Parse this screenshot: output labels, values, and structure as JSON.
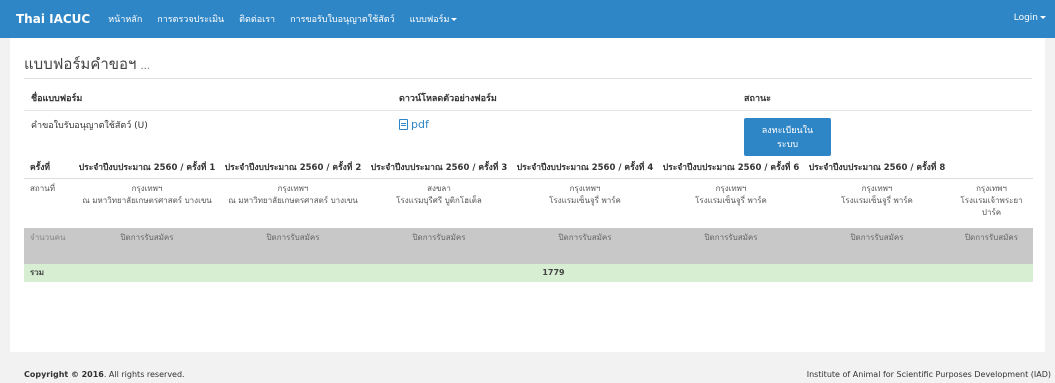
{
  "nav": {
    "brand": "Thai IACUC",
    "links": [
      "หน้าหลัก",
      "การตรวจประเมิน",
      "ติดต่อเรา",
      "การขอรับใบอนุญาตใช้สัตว์"
    ],
    "dropdown": "แบบฟอร์ม",
    "login": "Login"
  },
  "page": {
    "title": "แบบฟอร์มคำขอฯ",
    "title_suffix": "..."
  },
  "form_info": {
    "headers": [
      "ชื่อแบบฟอร์ม",
      "ดาวน์โหลดตัวอย่างฟอร์ม",
      "สถานะ"
    ],
    "name": "คำขอใบรับอนุญาตใช้สัตว์ (U)",
    "download_label": "pdf",
    "status_button": "ลงทะเบียนในระบบ"
  },
  "schedule": {
    "corner": "ครั้งที่",
    "rounds": [
      {
        "header": "ประจำปีงบประมาณ 2560 / ครั้งที่ 1",
        "place": "กรุงเทพฯ",
        "venue": "ณ มหาวิทยาลัยเกษตรศาสตร์ บางเขน",
        "count": "ปิดการรับสมัคร"
      },
      {
        "header": "ประจำปีงบประมาณ 2560 / ครั้งที่ 2",
        "place": "กรุงเทพฯ",
        "venue": "ณ มหาวิทยาลัยเกษตรศาสตร์ บางเขน",
        "count": "ปิดการรับสมัคร"
      },
      {
        "header": "ประจำปีงบประมาณ 2560 / ครั้งที่ 3",
        "place": "สงขลา",
        "venue": "โรงแรมบุรีศรี บูติกโฮเต็ล",
        "count": "ปิดการรับสมัคร"
      },
      {
        "header": "ประจำปีงบประมาณ 2560 / ครั้งที่ 4",
        "place": "กรุงเทพฯ",
        "venue": "โรงแรมเซ็นจูรี่ พาร์ค",
        "count": "ปิดการรับสมัคร"
      },
      {
        "header": "ประจำปีงบประมาณ 2560 / ครั้งที่ 6",
        "place": "กรุงเทพฯ",
        "venue": "โรงแรมเซ็นจูรี่ พาร์ค",
        "count": "ปิดการรับสมัคร"
      },
      {
        "header": "ประจำปีงบประมาณ 2560 / ครั้งที่ 8",
        "place": "กรุงเทพฯ",
        "venue": "โรงแรมเซ็นจูรี่ พาร์ค",
        "count": "ปิดการรับสมัคร"
      },
      {
        "header": "",
        "place": "กรุงเทพฯ",
        "venue": "โรงแรมเจ้าพระยาปาร์ค",
        "count": "ปิดการรับสมัคร"
      }
    ],
    "row_labels": {
      "place": "สถานที่",
      "count": "จำนวนคน",
      "total": "รวม"
    },
    "total": "1779"
  },
  "footer": {
    "copyright_prefix": "Copyright ©",
    "year": "2016",
    "rights": ". All rights reserved.",
    "org": "Institute of Animal for Scientific Purposes Development (IAD)"
  }
}
